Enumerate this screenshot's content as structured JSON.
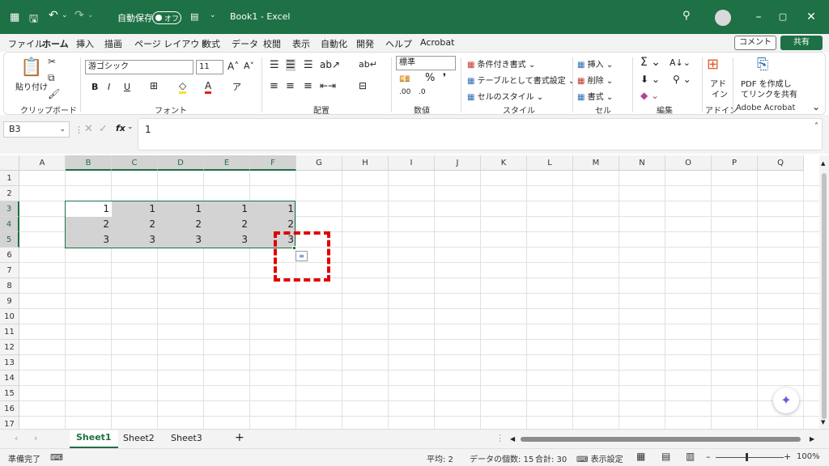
{
  "titlebar": {
    "autosave_label": "自動保存",
    "autosave_state": "オフ",
    "title": "Book1  -  Excel",
    "accent": "#1e7145"
  },
  "menu": {
    "tabs": [
      "ファイル",
      "ホーム",
      "挿入",
      "描画",
      "ページ レイアウト",
      "数式",
      "データ",
      "校閲",
      "表示",
      "自動化",
      "開発",
      "ヘルプ",
      "Acrobat"
    ],
    "active": "ホーム",
    "comment": "コメント",
    "share": "共有"
  },
  "ribbon": {
    "paste": "貼り付け",
    "clipboard": "クリップボード",
    "font_name": "游ゴシック",
    "font_size": "11",
    "font": "フォント",
    "align": "配置",
    "number_format": "標準",
    "number": "数値",
    "cond_format": "条件付き書式",
    "table_format": "テーブルとして書式設定",
    "cell_style": "セルのスタイル",
    "style": "スタイル",
    "insert": "挿入",
    "delete": "削除",
    "format": "書式",
    "cells": "セル",
    "edit": "編集",
    "addin_1": "アド",
    "addin_2": "イン",
    "addin": "アドイン",
    "pdf_1": "PDF を作成し",
    "pdf_2": "てリンクを共有",
    "adobe": "Adobe Acrobat"
  },
  "formula": {
    "namebox": "B3",
    "fx": "fx",
    "value": "1"
  },
  "grid": {
    "columns": [
      "A",
      "B",
      "C",
      "D",
      "E",
      "F",
      "G",
      "H",
      "I",
      "J",
      "K",
      "L",
      "M",
      "N",
      "O",
      "P",
      "Q"
    ],
    "rows": [
      "1",
      "2",
      "3",
      "4",
      "5",
      "6",
      "7",
      "8",
      "9",
      "10",
      "11",
      "12",
      "13",
      "14",
      "15",
      "16",
      "17"
    ],
    "values": [
      [
        "1",
        "1",
        "1",
        "1",
        "1"
      ],
      [
        "2",
        "2",
        "2",
        "2",
        "2"
      ],
      [
        "3",
        "3",
        "3",
        "3",
        "3"
      ]
    ]
  },
  "sheets": {
    "tabs": [
      "Sheet1",
      "Sheet2",
      "Sheet3"
    ],
    "active": "Sheet1",
    "add": "+"
  },
  "status": {
    "ready": "準備完了",
    "average": "平均: 2",
    "count": "データの個数: 15",
    "sum": "合計: 30",
    "display_settings": "表示設定",
    "zoom": "100%"
  }
}
